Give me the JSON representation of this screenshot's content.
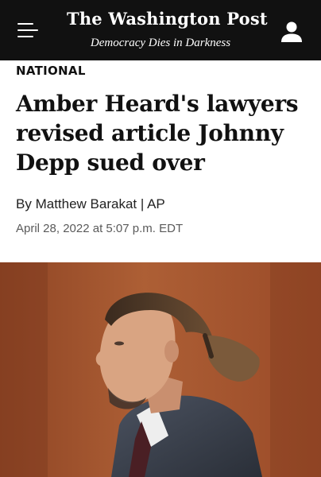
{
  "header": {
    "logo_text": "The Washington Post",
    "tagline": "Democracy Dies in Darkness",
    "menu_icon": "hamburger-menu-icon",
    "account_icon": "user-account-icon",
    "background_color": "#111111"
  },
  "article": {
    "section": "NATIONAL",
    "headline": "Amber Heard's lawyers revised article Johnny Depp sued over",
    "byline_prefix": "By",
    "author": "Matthew Barakat",
    "byline_separator": "|",
    "agency": "AP",
    "timestamp": "April 28, 2022 at 5:07 p.m. EDT"
  },
  "photo": {
    "subject": "portrait photo of a man with a ponytail in a courtroom",
    "background_color": "#a2552e"
  }
}
